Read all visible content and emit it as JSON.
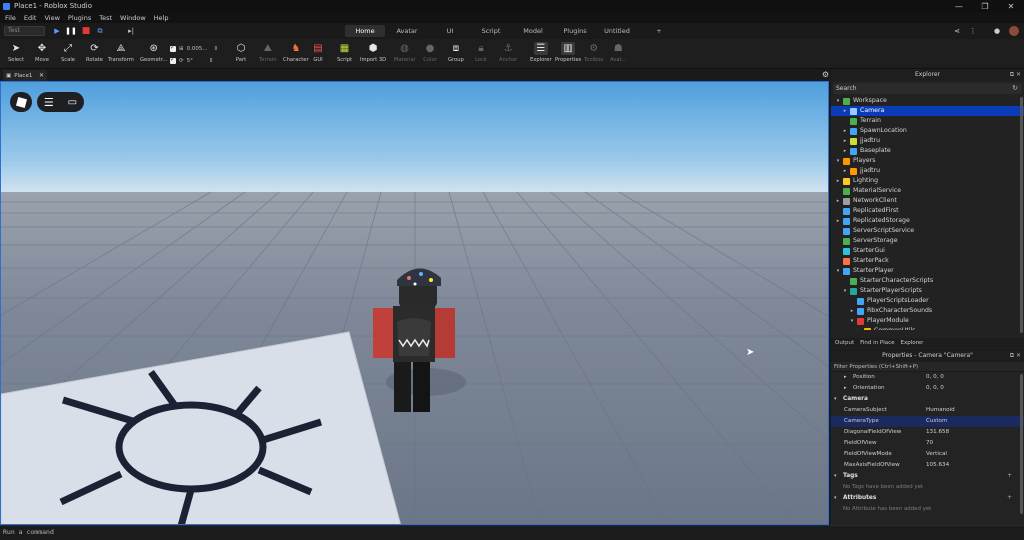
{
  "window": {
    "title": "Place1 - Roblox Studio",
    "controls": [
      "—",
      "❐",
      "✕"
    ]
  },
  "menu": [
    "File",
    "Edit",
    "View",
    "Plugins",
    "Test",
    "Window",
    "Help"
  ],
  "play": {
    "mode": "Test"
  },
  "ribbon_tabs": [
    {
      "label": "Home",
      "active": true
    },
    {
      "label": "Avatar"
    },
    {
      "label": "UI"
    },
    {
      "label": "Script"
    },
    {
      "label": "Model"
    },
    {
      "label": "Plugins"
    },
    {
      "label": "Untitled"
    },
    {
      "label": "+"
    }
  ],
  "tools": {
    "select": "Select",
    "move": "Move",
    "scale": "Scale",
    "rotate": "Rotate",
    "transform": "Transform",
    "geometry": "Geometr...",
    "part": "Part",
    "terrain": "Terrain",
    "character": "Character",
    "gui": "GUI",
    "script": "Script",
    "import3d": "Import 3D",
    "material": "Material",
    "color": "Color",
    "group": "Group",
    "lock": "Lock",
    "anchor": "Anchor",
    "explorer": "Explorer",
    "properties": "Properties",
    "toolbox": "Toolbox",
    "avatar": "Avat..."
  },
  "snap": {
    "move": "0.005...",
    "rotate": "5°"
  },
  "doc_tab": "Place1",
  "explorer": {
    "title": "Explorer",
    "search_placeholder": "Search",
    "items": [
      {
        "label": "Workspace",
        "depth": 0,
        "exp": "▾",
        "color": "#4caf50"
      },
      {
        "label": "Camera",
        "depth": 1,
        "exp": "▸",
        "color": "#9ecbff",
        "selected": true
      },
      {
        "label": "Terrain",
        "depth": 1,
        "exp": "",
        "color": "#4caf50"
      },
      {
        "label": "SpawnLocation",
        "depth": 1,
        "exp": "▸",
        "color": "#42a5f5"
      },
      {
        "label": "jjadtru",
        "depth": 1,
        "exp": "▸",
        "color": "#cddc39"
      },
      {
        "label": "Baseplate",
        "depth": 1,
        "exp": "▸",
        "color": "#42a5f5"
      },
      {
        "label": "Players",
        "depth": 0,
        "exp": "▾",
        "color": "#ff9800"
      },
      {
        "label": "jjadtru",
        "depth": 1,
        "exp": "▸",
        "color": "#ff9800"
      },
      {
        "label": "Lighting",
        "depth": 0,
        "exp": "▸",
        "color": "#ffca28"
      },
      {
        "label": "MaterialService",
        "depth": 0,
        "exp": "",
        "color": "#4caf50"
      },
      {
        "label": "NetworkClient",
        "depth": 0,
        "exp": "▸",
        "color": "#9e9e9e"
      },
      {
        "label": "ReplicatedFirst",
        "depth": 0,
        "exp": "",
        "color": "#42a5f5"
      },
      {
        "label": "ReplicatedStorage",
        "depth": 0,
        "exp": "▸",
        "color": "#42a5f5"
      },
      {
        "label": "ServerScriptService",
        "depth": 0,
        "exp": "",
        "color": "#42a5f5"
      },
      {
        "label": "ServerStorage",
        "depth": 0,
        "exp": "",
        "color": "#4caf50"
      },
      {
        "label": "StarterGui",
        "depth": 0,
        "exp": "",
        "color": "#26c6da"
      },
      {
        "label": "StarterPack",
        "depth": 0,
        "exp": "",
        "color": "#ff7043"
      },
      {
        "label": "StarterPlayer",
        "depth": 0,
        "exp": "▾",
        "color": "#42a5f5"
      },
      {
        "label": "StarterCharacterScripts",
        "depth": 1,
        "exp": "",
        "color": "#4caf50"
      },
      {
        "label": "StarterPlayerScripts",
        "depth": 1,
        "exp": "▾",
        "color": "#26a69a"
      },
      {
        "label": "PlayerScriptsLoader",
        "depth": 2,
        "exp": "",
        "color": "#42a5f5"
      },
      {
        "label": "RbxCharacterSounds",
        "depth": 2,
        "exp": "▸",
        "color": "#42a5f5"
      },
      {
        "label": "PlayerModule",
        "depth": 2,
        "exp": "▾",
        "color": "#e53935"
      },
      {
        "label": "CommonUtils",
        "depth": 3,
        "exp": "▸",
        "color": "#ffb300"
      }
    ]
  },
  "panel_tabs": [
    "Output",
    "Find in Place",
    "Explorer"
  ],
  "properties": {
    "title": "Properties - Camera \"Camera\"",
    "filter_placeholder": "Filter Properties (Ctrl+Shift+P)",
    "position_label": "Position",
    "position_value": "0, 0, 0",
    "orientation_label": "Orientation",
    "orientation_value": "0, 0, 0",
    "camera_section": "Camera",
    "rows": [
      {
        "name": "CameraSubject",
        "value": "Humanoid"
      },
      {
        "name": "CameraType",
        "value": "Custom",
        "selected": true
      },
      {
        "name": "DiagonalFieldOfView",
        "value": "131.658"
      },
      {
        "name": "FieldOfView",
        "value": "70"
      },
      {
        "name": "FieldOfViewMode",
        "value": "Vertical"
      },
      {
        "name": "MaxAxisFieldOfView",
        "value": "105.634"
      }
    ],
    "tags_section": "Tags",
    "tags_note": "No Tags have been added yet",
    "attributes_section": "Attributes",
    "attributes_note": "No Attribute has been added yet"
  },
  "command_placeholder": "Run a command",
  "colors": {
    "sky_top": "#5aa7e0",
    "sky_horizon": "#cfe0ee",
    "ground": "#7b8597",
    "selection": "#0b3cb7"
  }
}
